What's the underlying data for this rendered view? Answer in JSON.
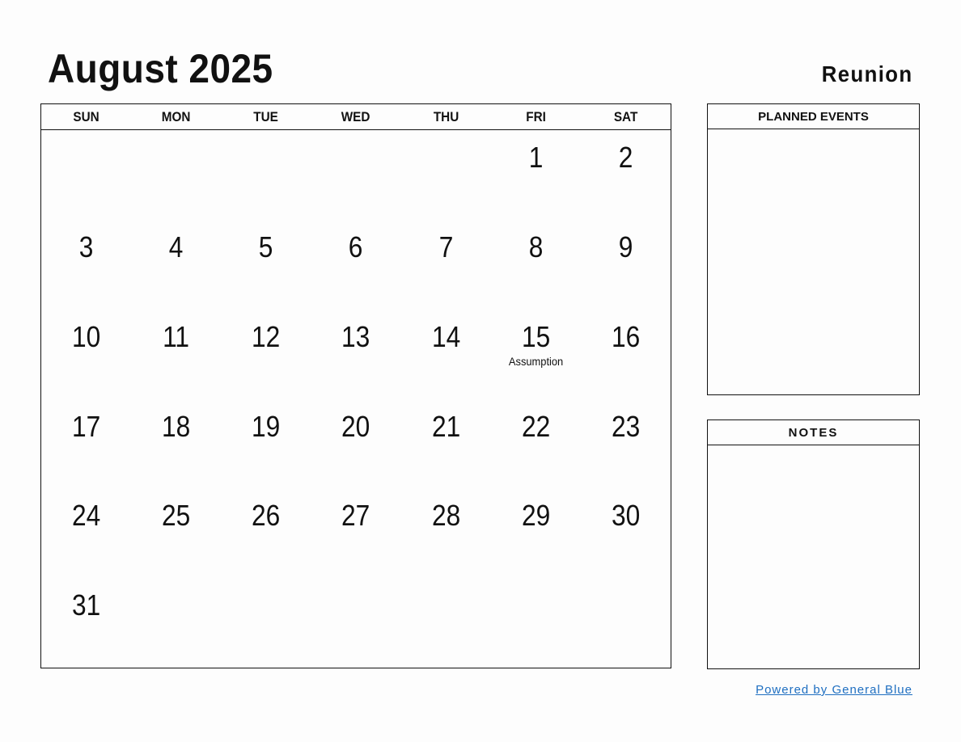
{
  "header": {
    "title": "August 2025",
    "country": "Reunion"
  },
  "calendar": {
    "weekdays": [
      "SUN",
      "MON",
      "TUE",
      "WED",
      "THU",
      "FRI",
      "SAT"
    ],
    "weeks": [
      [
        "",
        "",
        "",
        "",
        "",
        "1",
        "2"
      ],
      [
        "3",
        "4",
        "5",
        "6",
        "7",
        "8",
        "9"
      ],
      [
        "10",
        "11",
        "12",
        "13",
        "14",
        "15",
        "16"
      ],
      [
        "17",
        "18",
        "19",
        "20",
        "21",
        "22",
        "23"
      ],
      [
        "24",
        "25",
        "26",
        "27",
        "28",
        "29",
        "30"
      ],
      [
        "31",
        "",
        "",
        "",
        "",
        "",
        ""
      ]
    ],
    "holidays": {
      "15": "Assumption"
    }
  },
  "panels": {
    "events_title": "PLANNED EVENTS",
    "notes_title": "NOTES"
  },
  "footer": {
    "powered_by": "Powered by General Blue",
    "link_color": "#1f6fc1"
  }
}
